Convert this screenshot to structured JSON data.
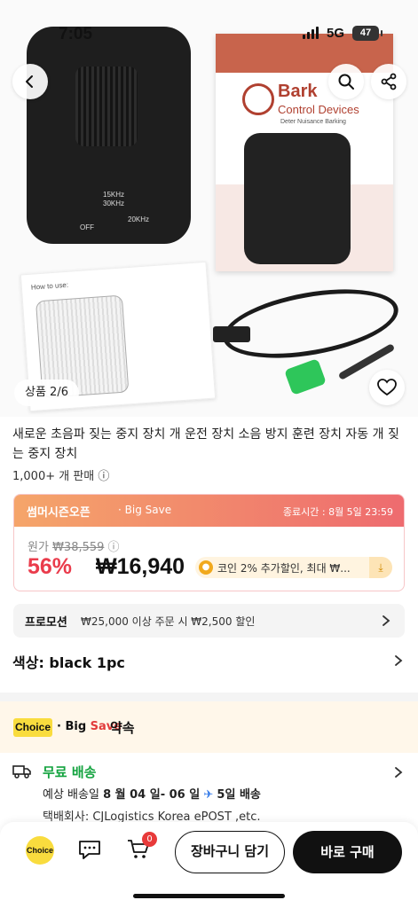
{
  "status_bar": {
    "time": "7:05",
    "network": "5G",
    "battery": "47"
  },
  "gallery": {
    "position_label": "상품 2/6",
    "product_art": {
      "box_brand_line1": "Bark",
      "box_brand_line2": "Control Devices",
      "box_tagline": "Deter Nuisance Barking",
      "device_label_1": "15KHz",
      "device_label_2": "30KHz",
      "device_label_3": "20KHz",
      "device_label_off": "OFF",
      "manual_title": "How to use:"
    }
  },
  "product": {
    "title": "새로운 초음파 짖는 중지 장치 개 운전 장치 소음 방지 훈련 장치 자동 개 짖는 중지 장치",
    "sold": "1,000+ 개 판매 ⓘ"
  },
  "deal": {
    "name": "썸머시즌오픈",
    "tag": "· Big Save",
    "end_time": "종료시간 : 8월 5일 23:59",
    "original_label": "원가",
    "original_price": "₩38,559",
    "info_icon": "ⓘ",
    "discount": "56%",
    "price": "₩16,940",
    "coin_text": "코인 2% 추가할인, 최대 ₩...",
    "colors": {
      "accent_red": "#ea3c4c",
      "header_from": "#f5a56a",
      "header_to": "#ee6b6f"
    }
  },
  "promotion": {
    "label": "프로모션",
    "text": "₩25,000 이상 주문 시 ₩2,500 할인"
  },
  "color_option": {
    "text": "색상: black 1pc"
  },
  "choice": {
    "logo": "Choice",
    "big_prefix": "· Big",
    "big_save": "Save",
    "promise": "약속"
  },
  "shipping": {
    "title": "무료 배송",
    "date_prefix": "예상 배송일",
    "date_range": "8 월 04 일- 06 일",
    "plane": "✈",
    "days": "5일 배송",
    "carrier": "택배회사:   CJLogistics    Korea ePOST ,etc."
  },
  "bottom_bar": {
    "choice_label": "Choice",
    "cart_count": "0",
    "add_to_cart": "장바구니 담기",
    "buy_now": "바로 구매"
  }
}
